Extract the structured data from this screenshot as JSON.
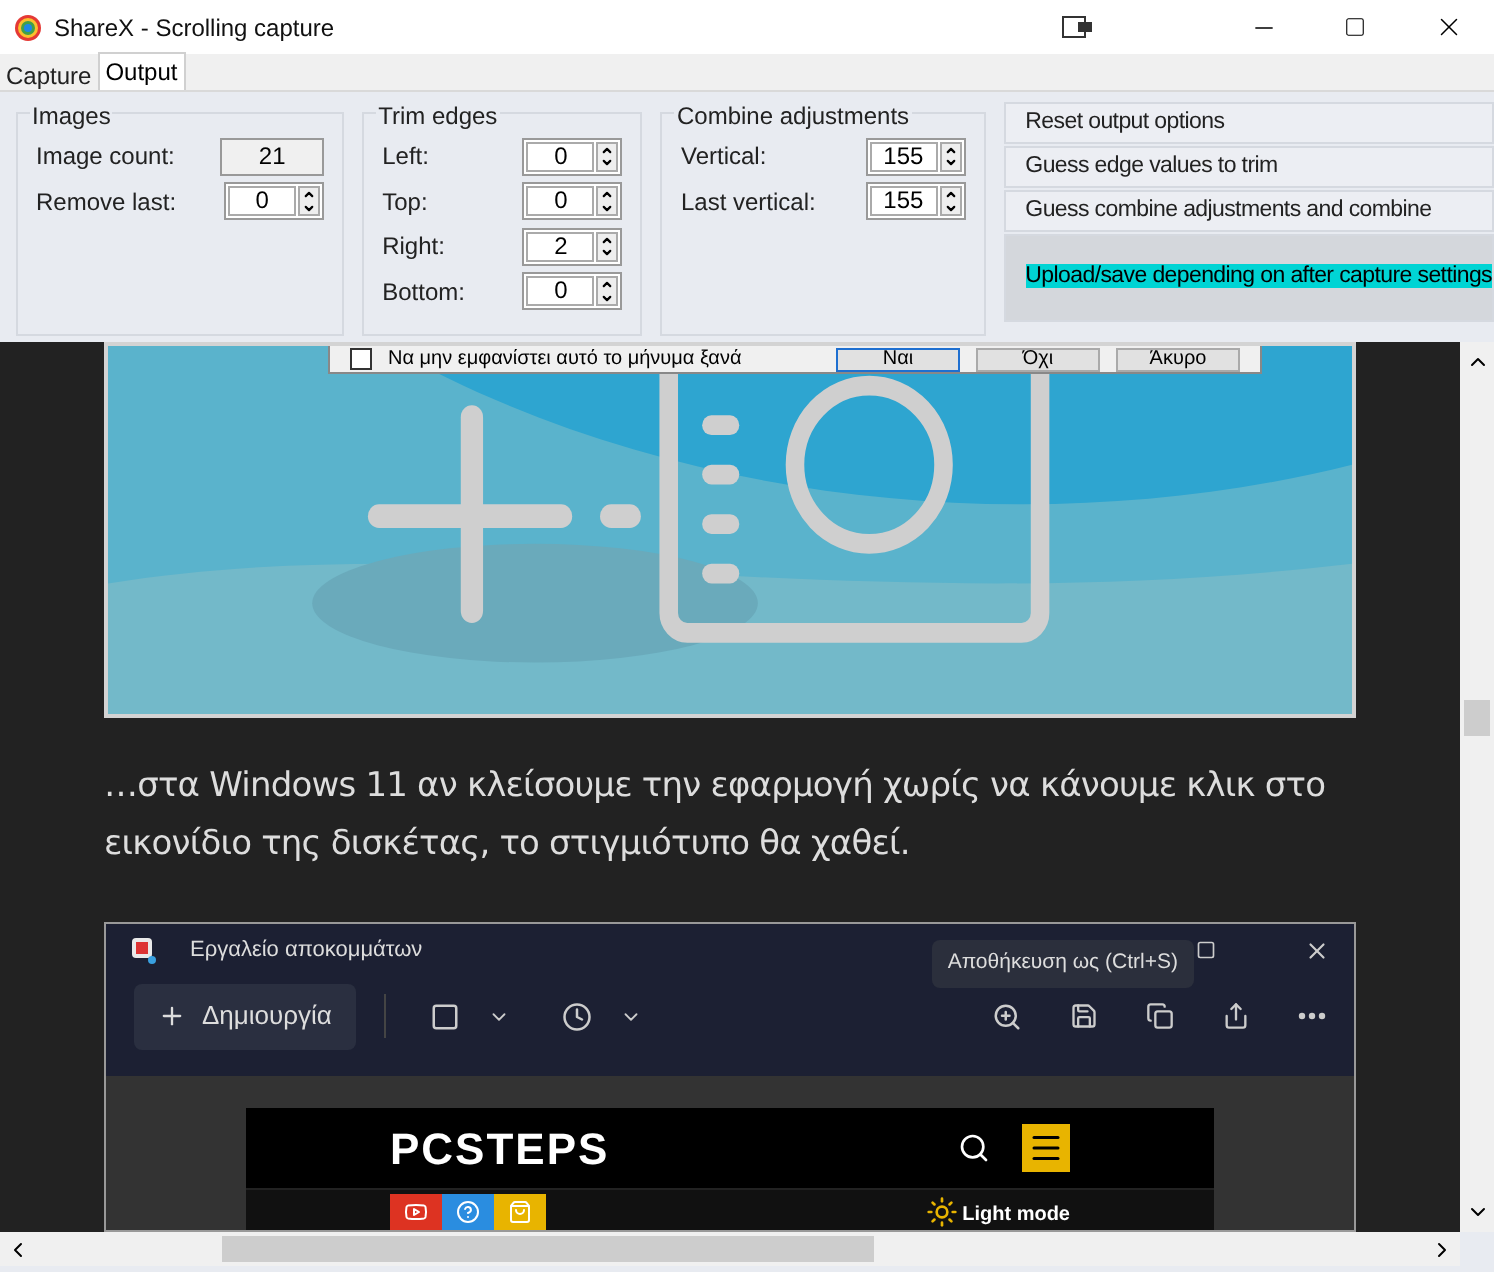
{
  "window": {
    "title": "ShareX - Scrolling capture"
  },
  "tabs": [
    {
      "label": "Capture",
      "selected": false
    },
    {
      "label": "Output",
      "selected": true
    }
  ],
  "groups": [
    {
      "title": "Images",
      "fields": [
        {
          "label": "Image count:",
          "value": "21",
          "kind": "readonly"
        },
        {
          "label": "Remove last:",
          "value": "0",
          "kind": "spinner"
        }
      ]
    },
    {
      "title": "Trim edges",
      "fields": [
        {
          "label": "Left:",
          "value": "0",
          "kind": "spinner"
        },
        {
          "label": "Top:",
          "value": "0",
          "kind": "spinner"
        },
        {
          "label": "Right:",
          "value": "2",
          "kind": "spinner"
        },
        {
          "label": "Bottom:",
          "value": "0",
          "kind": "spinner"
        }
      ]
    },
    {
      "title": "Combine adjustments",
      "fields": [
        {
          "label": "Vertical:",
          "value": "155",
          "kind": "spinner"
        },
        {
          "label": "Last vertical:",
          "value": "155",
          "kind": "spinner"
        }
      ]
    }
  ],
  "actions": [
    {
      "label": "Reset output options",
      "highlighted": false
    },
    {
      "label": "Guess edge values to trim",
      "highlighted": false
    },
    {
      "label": "Guess combine adjustments and combine",
      "highlighted": false
    },
    {
      "label": "Upload/save depending on after capture settings",
      "highlighted": true
    }
  ],
  "preview": {
    "dialog": {
      "checkbox_label": "Να μην εμφανίστει αυτό το μήνυμα ξανά",
      "checked": false,
      "buttons": [
        "Ναι",
        "Όχι",
        "Άκυρο"
      ]
    },
    "paragraph": "…στα Windows 11 αν κλείσουμε την εφαρμογή χωρίς να κάνουμε κλικ στο εικονίδιο της δισκέτας, το στιγμιότυπο θα χαθεί.",
    "snip_window": {
      "title": "Εργαλείο αποκομμάτων",
      "new_button": "Δημιουργία",
      "tooltip": "Αποθήκευση ως (Ctrl+S)",
      "logo": "PCSTEPS",
      "light_mode": "Light mode"
    }
  }
}
